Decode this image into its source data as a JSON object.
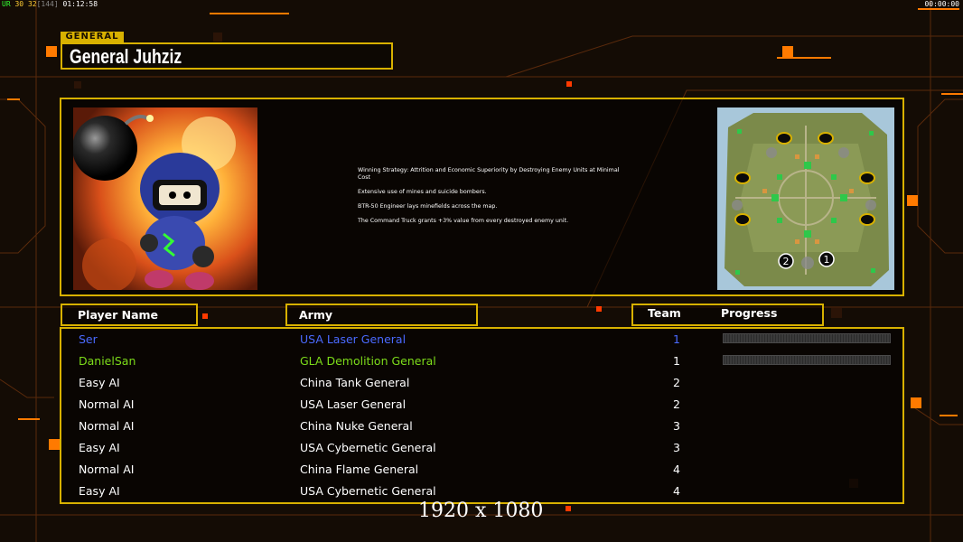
{
  "debug": {
    "fps_label": "UR",
    "fps_a": "30",
    "fps_b": "32",
    "fps_c": "[144]",
    "time": "01:12:58",
    "clock": "00:00:00"
  },
  "general": {
    "tag": "GENERAL",
    "name": "General Juhziz",
    "description": [
      "Winning Strategy: Attrition and Economic Superiority by Destroying Enemy Units at Minimal Cost",
      "Extensive use of mines and suicide bombers.",
      "BTR-50 Engineer lays minefields across the map.",
      "The Command Truck grants +3% value from every destroyed enemy unit."
    ]
  },
  "map": {
    "start_markers": [
      "2",
      "1"
    ]
  },
  "headers": {
    "player_name": "Player Name",
    "army": "Army",
    "team": "Team",
    "progress": "Progress"
  },
  "players": [
    {
      "name": "Ser",
      "army": "USA Laser General",
      "team": "1",
      "color": "#4a6aff",
      "team_color": "#4a6aff",
      "progress": 0.0
    },
    {
      "name": "DanielSan",
      "army": "GLA Demolition General",
      "team": "1",
      "color": "#7ddc1a",
      "team_color": "#ffffff",
      "progress": 0.0
    },
    {
      "name": "Easy AI",
      "army": "China Tank General",
      "team": "2",
      "color": "#ffffff",
      "team_color": "#ffffff"
    },
    {
      "name": "Normal AI",
      "army": "USA Laser General",
      "team": "2",
      "color": "#ffffff",
      "team_color": "#ffffff"
    },
    {
      "name": "Normal AI",
      "army": "China Nuke General",
      "team": "3",
      "color": "#ffffff",
      "team_color": "#ffffff"
    },
    {
      "name": "Easy AI",
      "army": "USA Cybernetic General",
      "team": "3",
      "color": "#ffffff",
      "team_color": "#ffffff"
    },
    {
      "name": "Normal AI",
      "army": "China Flame General",
      "team": "4",
      "color": "#ffffff",
      "team_color": "#ffffff"
    },
    {
      "name": "Easy AI",
      "army": "USA Cybernetic General",
      "team": "4",
      "color": "#ffffff",
      "team_color": "#ffffff"
    }
  ],
  "resolution_label": "1920 x 1080",
  "colors": {
    "frame": "#d8b100",
    "accent": "#ff7a00",
    "background": "#140c05"
  }
}
